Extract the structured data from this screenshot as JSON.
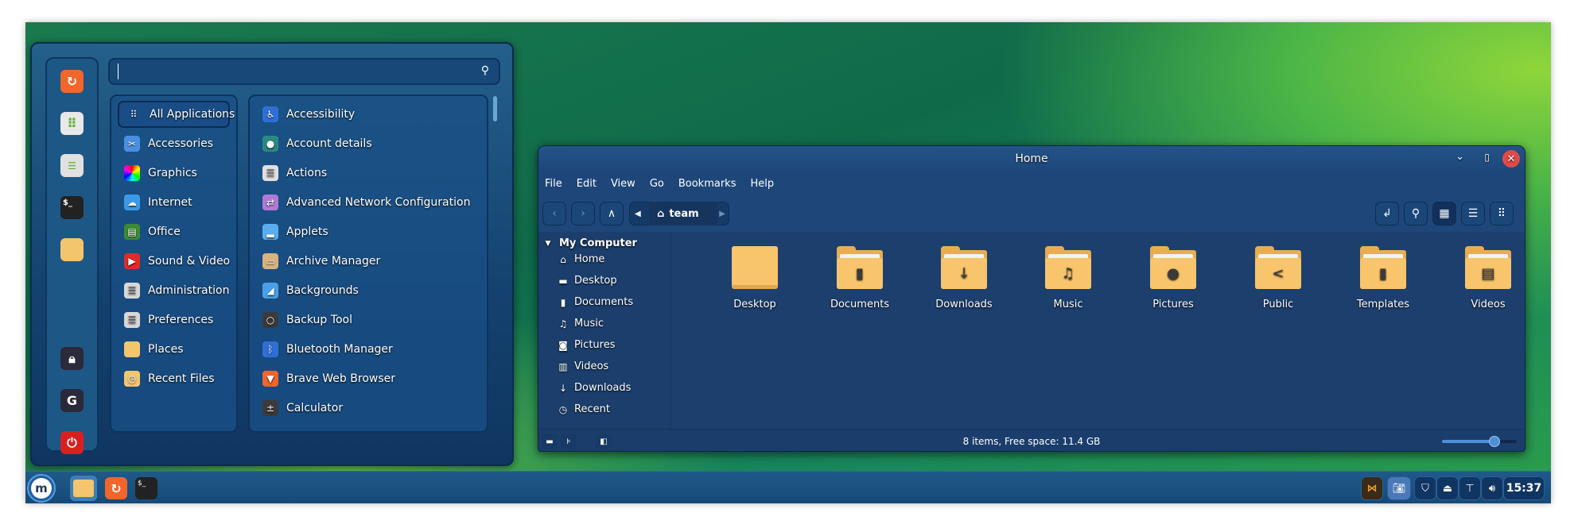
{
  "menu": {
    "search": {
      "value": "",
      "placeholder": ""
    },
    "favorites": [
      {
        "icon": "firefox-icon"
      },
      {
        "icon": "software-manager-icon"
      },
      {
        "icon": "settings-toggle-icon"
      },
      {
        "icon": "terminal-icon"
      },
      {
        "icon": "folder-icon"
      }
    ],
    "session": [
      {
        "icon": "lock-icon"
      },
      {
        "icon": "logout-icon"
      },
      {
        "icon": "power-icon"
      }
    ],
    "categories": [
      {
        "label": "All Applications",
        "icon": "grid-icon",
        "color": "#1a4d85"
      },
      {
        "label": "Accessories",
        "icon": "scissors-icon",
        "color": "#4a90e2"
      },
      {
        "label": "Graphics",
        "icon": "graphics-icon",
        "color": "#d63ad0"
      },
      {
        "label": "Internet",
        "icon": "cloud-icon",
        "color": "#3a9ae8"
      },
      {
        "label": "Office",
        "icon": "office-icon",
        "color": "#3c8a33"
      },
      {
        "label": "Sound & Video",
        "icon": "play-icon",
        "color": "#e02a2a"
      },
      {
        "label": "Administration",
        "icon": "admin-icon",
        "color": "#d8d8d8"
      },
      {
        "label": "Preferences",
        "icon": "preferences-icon",
        "color": "#d8d8d8"
      },
      {
        "label": "Places",
        "icon": "folder-icon",
        "color": "#f3c56c"
      },
      {
        "label": "Recent Files",
        "icon": "recent-folder-icon",
        "color": "#f3c56c"
      }
    ],
    "apps": [
      {
        "label": "Accessibility",
        "icon": "accessibility-icon",
        "color": "#2f6fd6"
      },
      {
        "label": "Account details",
        "icon": "account-icon",
        "color": "#2a8a80"
      },
      {
        "label": "Actions",
        "icon": "list-icon",
        "color": "#e0e0e0"
      },
      {
        "label": "Advanced Network Configuration",
        "icon": "network-arrows-icon",
        "color": "#b07ad8"
      },
      {
        "label": "Applets",
        "icon": "applets-icon",
        "color": "#5aaeee"
      },
      {
        "label": "Archive Manager",
        "icon": "archive-icon",
        "color": "#d9b27e"
      },
      {
        "label": "Backgrounds",
        "icon": "backgrounds-icon",
        "color": "#4aa0e8"
      },
      {
        "label": "Backup Tool",
        "icon": "backup-icon",
        "color": "#3a3a3a"
      },
      {
        "label": "Bluetooth Manager",
        "icon": "bluetooth-icon",
        "color": "#2f6fd6"
      },
      {
        "label": "Brave Web Browser",
        "icon": "brave-icon",
        "color": "#f2652b"
      },
      {
        "label": "Calculator",
        "icon": "calculator-icon",
        "color": "#3a3a3a"
      }
    ]
  },
  "filemanager": {
    "title": "Home",
    "menus": [
      "File",
      "Edit",
      "View",
      "Go",
      "Bookmarks",
      "Help"
    ],
    "breadcrumb": "team",
    "sidebar": {
      "header": "My Computer",
      "items": [
        {
          "label": "Home",
          "icon": "home-icon"
        },
        {
          "label": "Desktop",
          "icon": "desktop-icon"
        },
        {
          "label": "Documents",
          "icon": "document-icon"
        },
        {
          "label": "Music",
          "icon": "music-icon"
        },
        {
          "label": "Pictures",
          "icon": "camera-icon"
        },
        {
          "label": "Videos",
          "icon": "film-icon"
        },
        {
          "label": "Downloads",
          "icon": "download-icon"
        },
        {
          "label": "Recent",
          "icon": "clock-icon"
        }
      ]
    },
    "folders": [
      {
        "label": "Desktop",
        "glyph": ""
      },
      {
        "label": "Documents",
        "glyph": "▮"
      },
      {
        "label": "Downloads",
        "glyph": "↓"
      },
      {
        "label": "Music",
        "glyph": "♫"
      },
      {
        "label": "Pictures",
        "glyph": "●"
      },
      {
        "label": "Public",
        "glyph": "<"
      },
      {
        "label": "Templates",
        "glyph": "▮"
      },
      {
        "label": "Videos",
        "glyph": "▤"
      }
    ],
    "status": "8 items, Free space: 11.4 GB",
    "zoom_level": 0.7
  },
  "taskbar": {
    "clock": "15:37"
  }
}
